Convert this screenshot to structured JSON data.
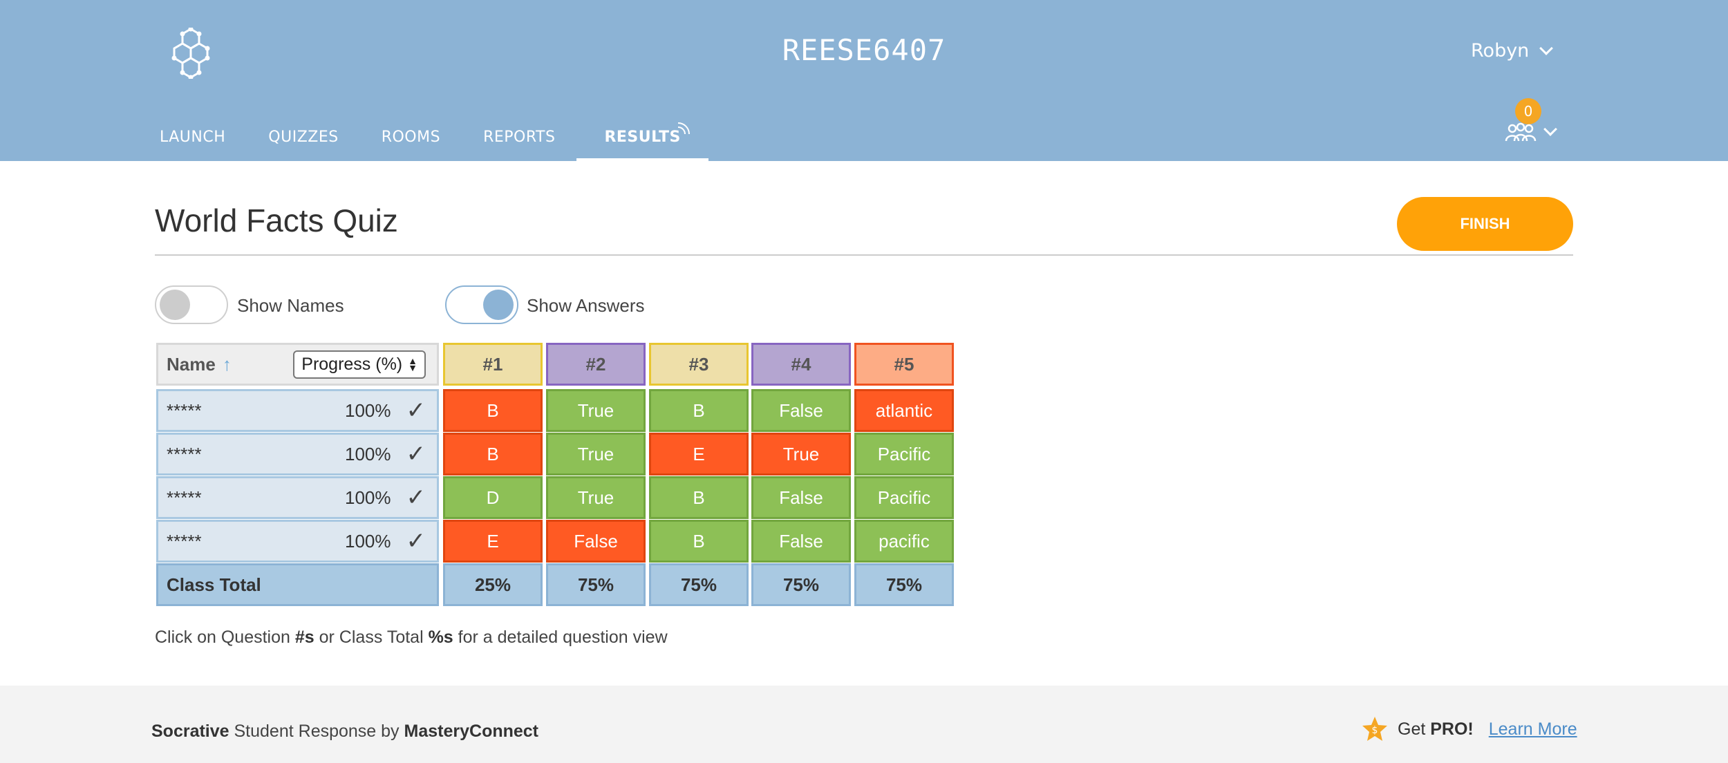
{
  "header": {
    "room_name": "REESE6407",
    "user_name": "Robyn",
    "student_count": "0",
    "nav": [
      {
        "label": "LAUNCH"
      },
      {
        "label": "QUIZZES"
      },
      {
        "label": "ROOMS"
      },
      {
        "label": "REPORTS"
      },
      {
        "label": "RESULTS",
        "active": true
      }
    ],
    "icons": {
      "logo": "socrative-hex-logo",
      "user_menu": "chevron-down-icon",
      "students": "students-icon"
    }
  },
  "main": {
    "quiz_title": "World Facts Quiz",
    "finish_label": "FINISH",
    "toggles": [
      {
        "label": "Show Names",
        "on": false
      },
      {
        "label": "Show Answers",
        "on": true
      }
    ],
    "grid": {
      "name_header": "Name",
      "sort_icon": "arrow-up-icon",
      "sort_select": "Progress (%)",
      "questions": [
        "#1",
        "#2",
        "#3",
        "#4",
        "#5"
      ],
      "rows": [
        {
          "name": "*****",
          "progress": "100%",
          "answers": [
            "B",
            "True",
            "B",
            "False",
            "atlantic"
          ]
        },
        {
          "name": "*****",
          "progress": "100%",
          "answers": [
            "B",
            "True",
            "E",
            "True",
            "Pacific"
          ]
        },
        {
          "name": "*****",
          "progress": "100%",
          "answers": [
            "D",
            "True",
            "B",
            "False",
            "Pacific"
          ]
        },
        {
          "name": "*****",
          "progress": "100%",
          "answers": [
            "E",
            "False",
            "B",
            "False",
            "pacific"
          ]
        }
      ],
      "total_label": "Class Total",
      "totals": [
        "25%",
        "75%",
        "75%",
        "75%",
        "75%"
      ]
    },
    "hint": {
      "part1": "Click on Question ",
      "b1": "#s",
      "part2": " or Class Total ",
      "b2": "%s",
      "part3": " for a detailed question view"
    }
  },
  "footer": {
    "brand1": "Socrative",
    "brand2": " Student Response by ",
    "brand3": "MasteryConnect",
    "get": "Get ",
    "pro": "PRO!",
    "learn_more": "Learn More"
  },
  "colors": {
    "header_bg": "#8cb3d5",
    "finish": "#ffa208",
    "correct": "#8dc056",
    "incorrect": "#ff5a23",
    "badge": "#f5a623"
  }
}
